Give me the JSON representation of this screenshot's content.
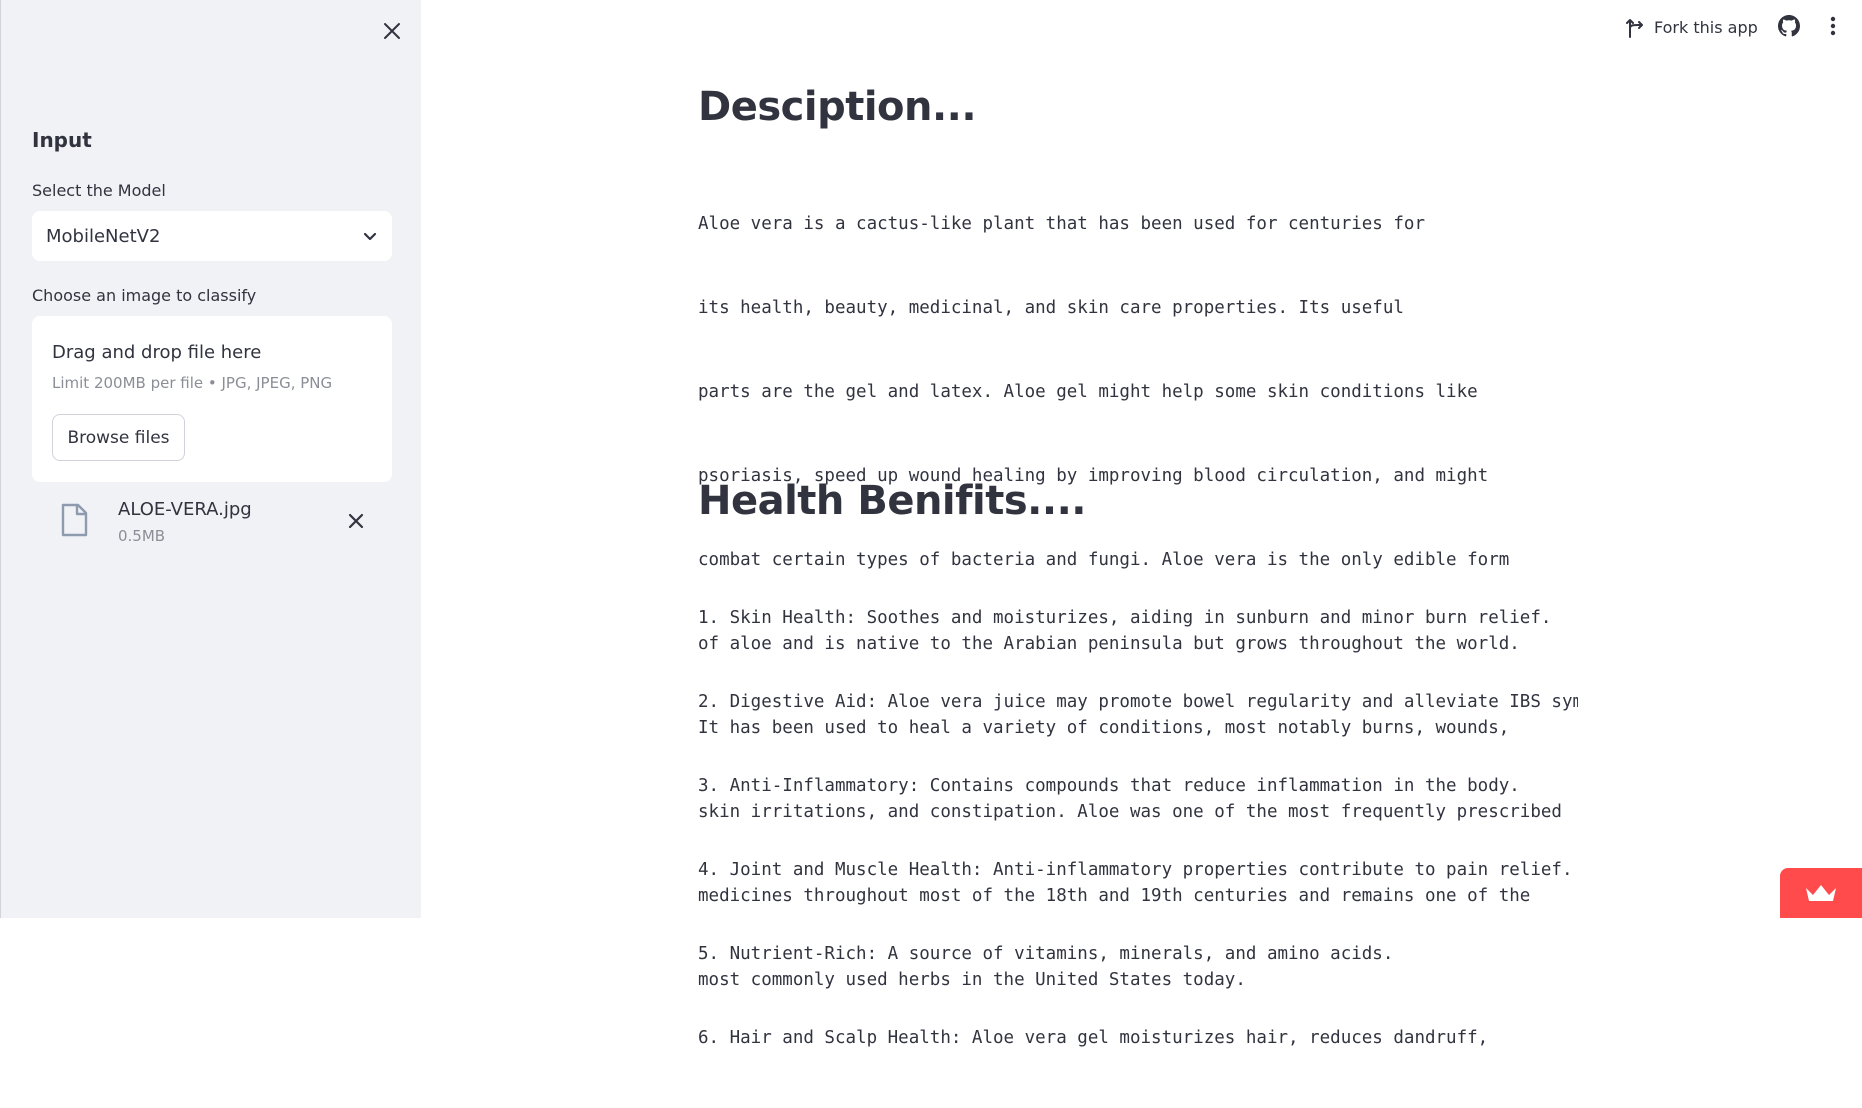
{
  "sidebar": {
    "heading": "Input",
    "model_label": "Select the Model",
    "model_value": "MobileNetV2",
    "upload_label": "Choose an image to classify",
    "dropzone": {
      "title": "Drag and drop file here",
      "hint": "Limit 200MB per file • JPG, JPEG, PNG",
      "browse_label": "Browse files"
    },
    "file": {
      "name": "ALOE-VERA.jpg",
      "size": "0.5MB"
    }
  },
  "toolbar": {
    "fork_label": "Fork this app"
  },
  "main": {
    "description_title": "Desciption...",
    "description_lines": [
      "Aloe vera is a cactus-like plant that has been used for centuries for",
      "its health, beauty, medicinal, and skin care properties. Its useful",
      "parts are the gel and latex. Aloe gel might help some skin conditions like",
      "psoriasis, speed up wound healing by improving blood circulation, and might",
      "combat certain types of bacteria and fungi. Aloe vera is the only edible form",
      "of aloe and is native to the Arabian peninsula but grows throughout the world.",
      "It has been used to heal a variety of conditions, most notably burns, wounds,",
      "skin irritations, and constipation. Aloe was one of the most frequently prescribed",
      "medicines throughout most of the 18th and 19th centuries and remains one of the",
      "most commonly used herbs in the United States today."
    ],
    "benefits_title": "Health Benifits....",
    "benefits_lines": [
      "1. Skin Health: Soothes and moisturizes, aiding in sunburn and minor burn relief.",
      "2. Digestive Aid: Aloe vera juice may promote bowel regularity and alleviate IBS sym",
      "3. Anti-Inflammatory: Contains compounds that reduce inflammation in the body.",
      "4. Joint and Muscle Health: Anti-inflammatory properties contribute to pain relief.",
      "5. Nutrient-Rich: A source of vitamins, minerals, and amino acids.",
      "6. Hair and Scalp Health: Aloe vera gel moisturizes hair, reduces dandruff,"
    ]
  },
  "icons": {
    "close": "close-icon",
    "chevron": "chevron-down-icon",
    "file": "file-icon",
    "fork": "fork-icon",
    "github": "github-icon",
    "menu": "more-vertical-icon",
    "streamlit": "streamlit-crown-icon"
  },
  "colors": {
    "sidebar_bg": "#f0f2f6",
    "text": "#31333f",
    "muted": "#8b8e96",
    "badge": "#ff4b4b"
  }
}
